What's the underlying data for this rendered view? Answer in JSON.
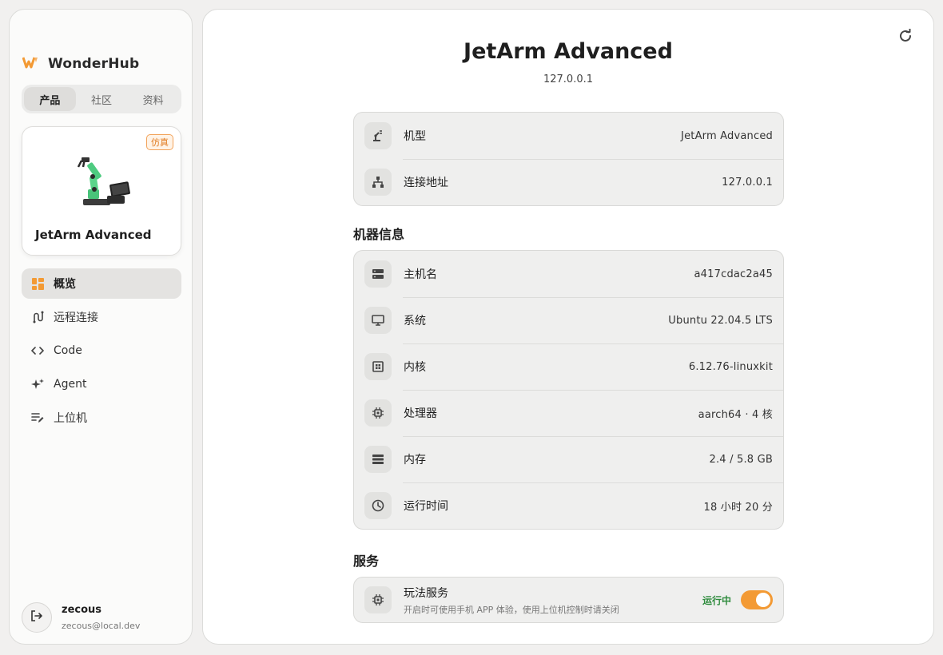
{
  "sidebar": {
    "brand": "WonderHub",
    "tabs": [
      "产品",
      "社区",
      "资料"
    ],
    "device": {
      "badge": "仿真",
      "name": "JetArm Advanced"
    },
    "nav": [
      {
        "label": "概览"
      },
      {
        "label": "远程连接"
      },
      {
        "label": "Code"
      },
      {
        "label": "Agent"
      },
      {
        "label": "上位机"
      }
    ],
    "user": {
      "name": "zecous",
      "email": "zecous@local.dev"
    }
  },
  "main": {
    "title": "JetArm Advanced",
    "subtitle": "127.0.0.1",
    "top_rows": [
      {
        "label": "机型",
        "value": "JetArm Advanced"
      },
      {
        "label": "连接地址",
        "value": "127.0.0.1"
      }
    ],
    "machine_info_title": "机器信息",
    "machine_rows": [
      {
        "label": "主机名",
        "value": "a417cdac2a45"
      },
      {
        "label": "系统",
        "value": "Ubuntu 22.04.5 LTS"
      },
      {
        "label": "内核",
        "value": "6.12.76-linuxkit"
      },
      {
        "label": "处理器",
        "value": "aarch64 · 4 核"
      },
      {
        "label": "内存",
        "value": "2.4 / 5.8 GB"
      },
      {
        "label": "运行时间",
        "value": "18 小时 20 分"
      }
    ],
    "services_title": "服务",
    "service": {
      "title": "玩法服务",
      "desc": "开启时可使用手机 APP 体验，使用上位机控制时请关闭",
      "status": "运行中",
      "enabled": true
    }
  },
  "colors": {
    "accent": "#f39a34",
    "running": "#2e8b3d",
    "badge": "#e07b20"
  }
}
